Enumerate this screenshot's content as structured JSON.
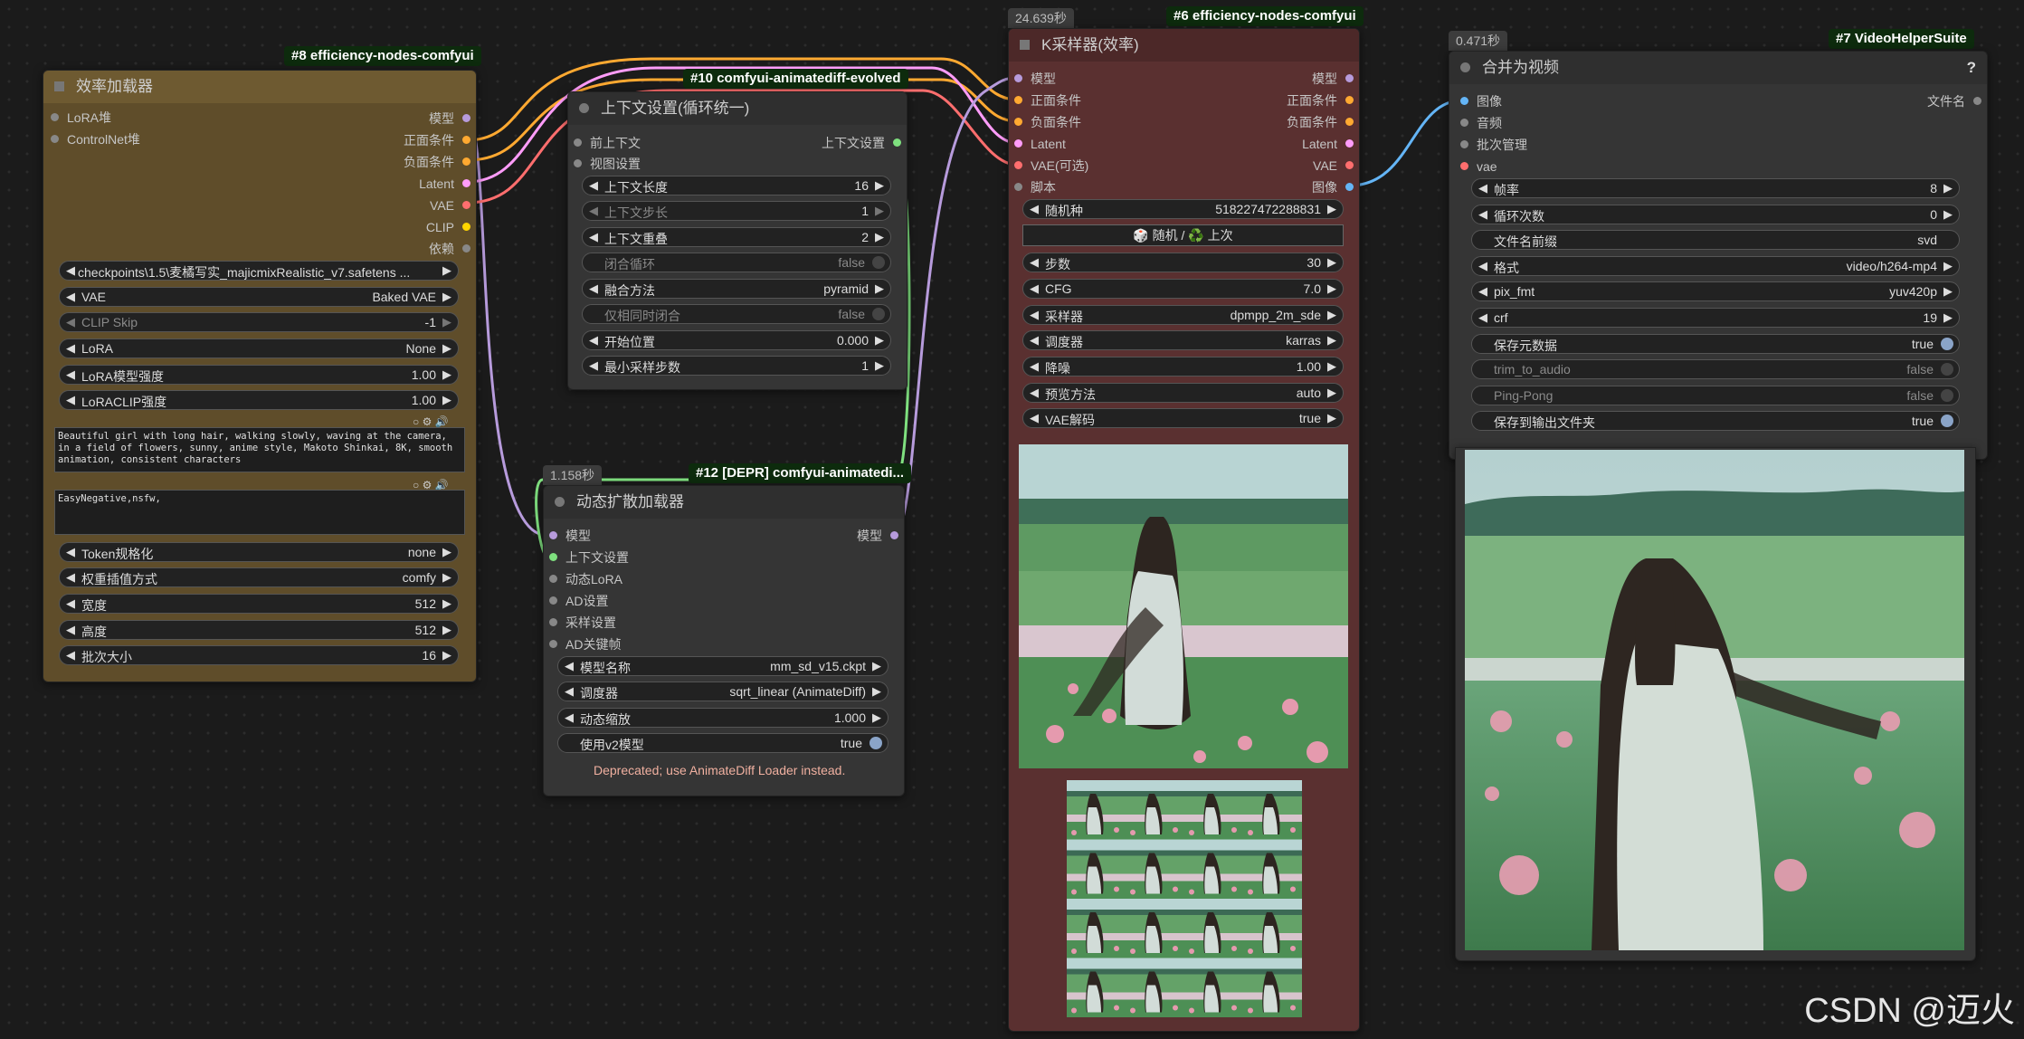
{
  "colors": {
    "model": "#b79bdc",
    "conditioning": "#ffa931",
    "latent": "#ff9cf9",
    "vae": "#ff6e6e",
    "clip": "#ffd500",
    "image": "#64b5f6",
    "context": "#7fe07f",
    "other": "#888888"
  },
  "node8": {
    "badge": "#8 efficiency-nodes-comfyui",
    "title": "效率加载器",
    "inputs": [
      "LoRA堆",
      "ControlNet堆"
    ],
    "outputs": [
      "模型",
      "正面条件",
      "负面条件",
      "Latent",
      "VAE",
      "CLIP",
      "依赖"
    ],
    "widgets": [
      {
        "value": "checkpoints\\1.5\\麦橘写实_majicmixRealistic_v7.safetens ..."
      },
      {
        "label": "VAE",
        "value": "Baked VAE"
      },
      {
        "label": "CLIP Skip",
        "value": "-1"
      },
      {
        "label": "LoRA",
        "value": "None"
      },
      {
        "label": "LoRA模型强度",
        "value": "1.00"
      },
      {
        "label": "LoRACLIP强度",
        "value": "1.00"
      }
    ],
    "positive_prompt": "Beautiful girl with long hair, walking slowly, waving at the camera, in a field of flowers, sunny, anime style, Makoto Shinkai, 8K, smooth animation, consistent characters",
    "negative_prompt": "EasyNegative,nsfw,",
    "widgets2": [
      {
        "label": "Token规格化",
        "value": "none"
      },
      {
        "label": "权重插值方式",
        "value": "comfy"
      },
      {
        "label": "宽度",
        "value": "512"
      },
      {
        "label": "高度",
        "value": "512"
      },
      {
        "label": "批次大小",
        "value": "16"
      }
    ]
  },
  "node10": {
    "badge": "#10 comfyui-animatediff-evolved",
    "title": "上下文设置(循环统一)",
    "inputs": [
      "前上下文",
      "视图设置"
    ],
    "output": "上下文设置",
    "widgets": [
      {
        "label": "上下文长度",
        "value": "16"
      },
      {
        "label": "上下文步长",
        "value": "1"
      },
      {
        "label": "上下文重叠",
        "value": "2"
      },
      {
        "label": "闭合循环",
        "value": "false"
      },
      {
        "label": "融合方法",
        "value": "pyramid"
      },
      {
        "label": "仅相同时闭合",
        "value": "false"
      },
      {
        "label": "开始位置",
        "value": "0.000"
      },
      {
        "label": "最小采样步数",
        "value": "1"
      }
    ]
  },
  "node12": {
    "timer": "1.158秒",
    "badge": "#12 [DEPR] comfyui-animatedi...",
    "title": "动态扩散加载器",
    "inputs": [
      "模型",
      "上下文设置",
      "动态LoRA",
      "AD设置",
      "采样设置",
      "AD关键帧"
    ],
    "output": "模型",
    "widgets": [
      {
        "label": "模型名称",
        "value": "mm_sd_v15.ckpt"
      },
      {
        "label": "调度器",
        "value": "sqrt_linear (AnimateDiff)"
      },
      {
        "label": "动态缩放",
        "value": "1.000"
      },
      {
        "label": "使用v2模型",
        "value": "true"
      }
    ],
    "deprecated": "Deprecated; use AnimateDiff Loader instead."
  },
  "node6": {
    "timer": "24.639秒",
    "badge": "#6 efficiency-nodes-comfyui",
    "title": "K采样器(效率)",
    "inputs": [
      "模型",
      "正面条件",
      "负面条件",
      "Latent",
      "VAE(可选)",
      "脚本"
    ],
    "outputs": [
      "模型",
      "正面条件",
      "负面条件",
      "Latent",
      "VAE",
      "图像"
    ],
    "seed": {
      "label": "随机种",
      "value": "518227472288831"
    },
    "seed_button": "🎲 随机 / ♻️ 上次",
    "widgets": [
      {
        "label": "步数",
        "value": "30"
      },
      {
        "label": "CFG",
        "value": "7.0"
      },
      {
        "label": "采样器",
        "value": "dpmpp_2m_sde"
      },
      {
        "label": "调度器",
        "value": "karras"
      },
      {
        "label": "降噪",
        "value": "1.00"
      },
      {
        "label": "预览方法",
        "value": "auto"
      },
      {
        "label": "VAE解码",
        "value": "true"
      }
    ]
  },
  "node7": {
    "timer": "0.471秒",
    "badge": "#7 VideoHelperSuite",
    "title": "合并为视频",
    "help": "?",
    "inputs": [
      "图像",
      "音频",
      "批次管理",
      "vae"
    ],
    "output": "文件名",
    "widgets": [
      {
        "label": "帧率",
        "value": "8"
      },
      {
        "label": "循环次数",
        "value": "0"
      },
      {
        "label": "文件名前缀",
        "value": "svd"
      },
      {
        "label": "格式",
        "value": "video/h264-mp4"
      },
      {
        "label": "pix_fmt",
        "value": "yuv420p"
      },
      {
        "label": "crf",
        "value": "19"
      },
      {
        "label": "保存元数据",
        "value": "true"
      },
      {
        "label": "trim_to_audio",
        "value": "false"
      },
      {
        "label": "Ping-Pong",
        "value": "false"
      },
      {
        "label": "保存到输出文件夹",
        "value": "true"
      }
    ]
  },
  "watermark": "CSDN @迈火"
}
